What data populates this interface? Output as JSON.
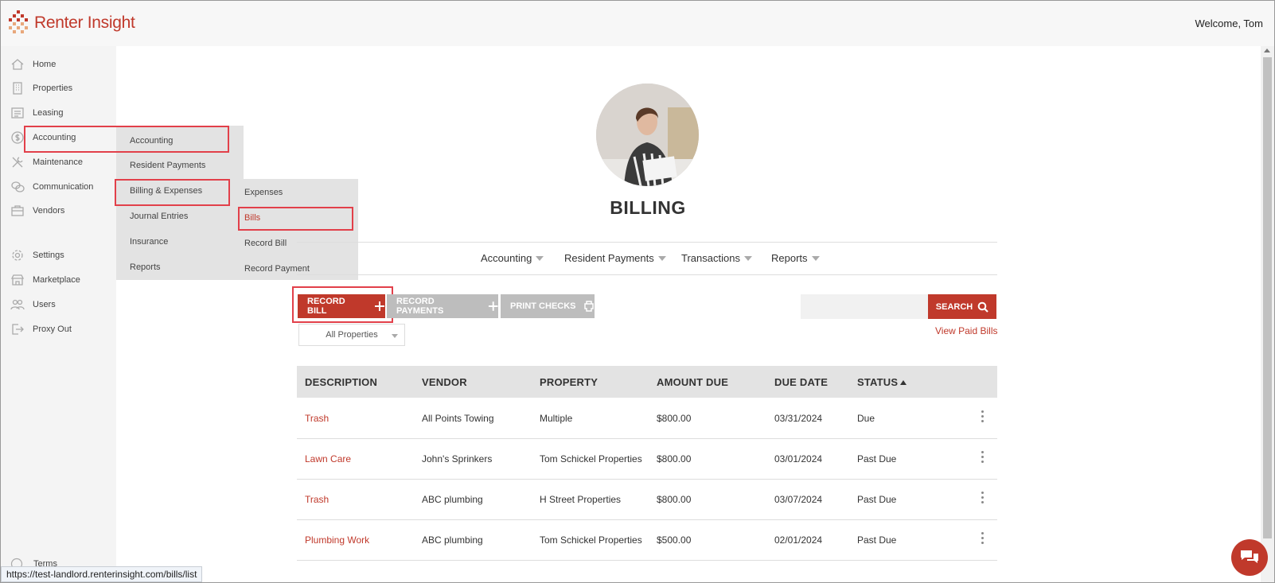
{
  "app": {
    "brand": "Renter Insight",
    "welcome": "Welcome, Tom",
    "accent": "#c0392b"
  },
  "sidebar": {
    "items": [
      {
        "label": "Home",
        "icon": "home-icon"
      },
      {
        "label": "Properties",
        "icon": "building-icon"
      },
      {
        "label": "Leasing",
        "icon": "list-icon"
      },
      {
        "label": "Accounting",
        "icon": "dollar-icon"
      },
      {
        "label": "Maintenance",
        "icon": "tools-icon"
      },
      {
        "label": "Communication",
        "icon": "chat-bubbles-icon"
      },
      {
        "label": "Vendors",
        "icon": "briefcase-icon"
      },
      {
        "label": "Settings",
        "icon": "gear-icon"
      },
      {
        "label": "Marketplace",
        "icon": "store-icon"
      },
      {
        "label": "Users",
        "icon": "users-icon"
      },
      {
        "label": "Proxy Out",
        "icon": "sign-out-icon"
      }
    ],
    "terms": "Terms"
  },
  "flyout_accounting": [
    "Accounting",
    "Resident Payments",
    "Billing & Expenses",
    "Journal Entries",
    "Insurance",
    "Reports"
  ],
  "flyout_billing": [
    "Expenses",
    "Bills",
    "Record Bill",
    "Record Payment"
  ],
  "page": {
    "title": "BILLING"
  },
  "tabs": [
    "Accounting",
    "Resident Payments",
    "Transactions",
    "Reports"
  ],
  "actions": {
    "record_bill": "RECORD BILL",
    "record_payments": "RECORD PAYMENTS",
    "print_checks": "PRINT CHECKS",
    "search": "SEARCH",
    "view_paid": "View Paid Bills",
    "property_filter": "All Properties"
  },
  "table": {
    "headers": [
      "DESCRIPTION",
      "VENDOR",
      "PROPERTY",
      "AMOUNT DUE",
      "DUE DATE",
      "STATUS"
    ],
    "rows": [
      {
        "description": "Trash",
        "vendor": "All Points Towing",
        "property": "Multiple",
        "amount": "$800.00",
        "due": "03/31/2024",
        "status": "Due"
      },
      {
        "description": "Lawn Care",
        "vendor": "John's Sprinkers",
        "property": "Tom Schickel Properties",
        "amount": "$800.00",
        "due": "03/01/2024",
        "status": "Past Due"
      },
      {
        "description": "Trash",
        "vendor": "ABC plumbing",
        "property": "H Street Properties",
        "amount": "$800.00",
        "due": "03/07/2024",
        "status": "Past Due"
      },
      {
        "description": "Plumbing Work",
        "vendor": "ABC plumbing",
        "property": "Tom Schickel Properties",
        "amount": "$500.00",
        "due": "02/01/2024",
        "status": "Past Due"
      }
    ]
  },
  "status_url": "https://test-landlord.renterinsight.com/bills/list"
}
